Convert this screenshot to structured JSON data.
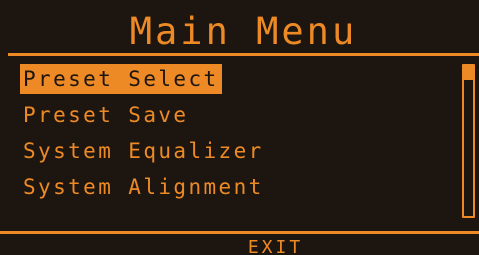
{
  "screen": {
    "title": "Main Menu",
    "footer": {
      "exit_label": "EXIT"
    }
  },
  "menu": {
    "items": [
      {
        "label": "Preset Select",
        "selected": true
      },
      {
        "label": "Preset Save",
        "selected": false
      },
      {
        "label": "System Equalizer",
        "selected": false
      },
      {
        "label": "System Alignment",
        "selected": false
      }
    ]
  },
  "colors": {
    "accent": "#ee8a26",
    "background": "#1d1610"
  }
}
